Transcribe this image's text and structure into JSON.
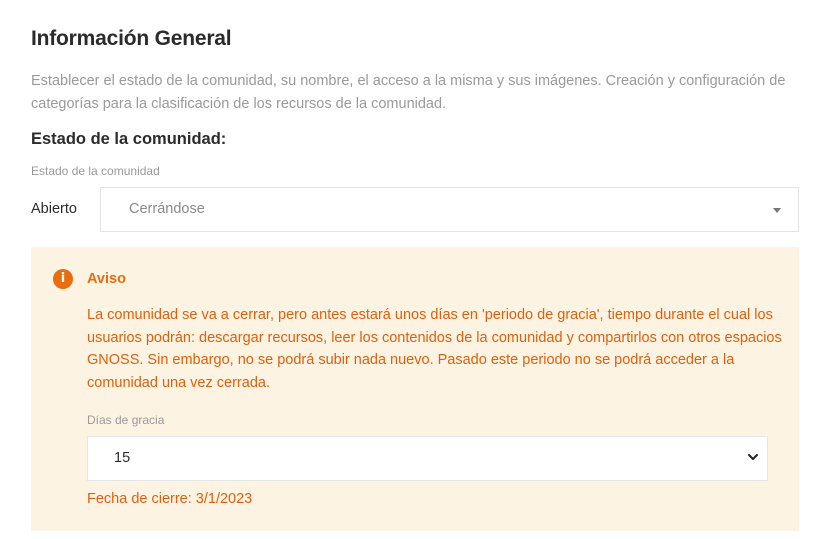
{
  "page": {
    "title": "Información General",
    "description": "Establecer el estado de la comunidad, su nombre, el acceso a la misma y sus imágenes. Creación y configuración de categorías para la clasificación de los recursos de la comunidad."
  },
  "state_section": {
    "heading": "Estado de la comunidad:",
    "field_label": "Estado de la comunidad",
    "current_state_label": "Abierto",
    "select_value": "Cerrándose"
  },
  "warning": {
    "icon": "info-icon",
    "icon_glyph": "i",
    "title": "Aviso",
    "text": "La comunidad se va a cerrar, pero antes estará unos días en 'periodo de gracia', tiempo durante el cual los usuarios podrán: descargar recursos, leer los contenidos de la comunidad y compartirlos con otros espacios GNOSS. Sin embargo, no se podrá subir nada nuevo. Pasado este periodo no se podrá acceder a la comunidad una vez cerrada.",
    "grace_label": "Días de gracia",
    "grace_value": "15",
    "close_date": "Fecha de cierre: 3/1/2023"
  },
  "colors": {
    "warning_accent": "#e96c0e",
    "warning_background": "#fdf3e3",
    "heading_text": "#2b2b2b",
    "muted_text": "#9a9a9a"
  }
}
